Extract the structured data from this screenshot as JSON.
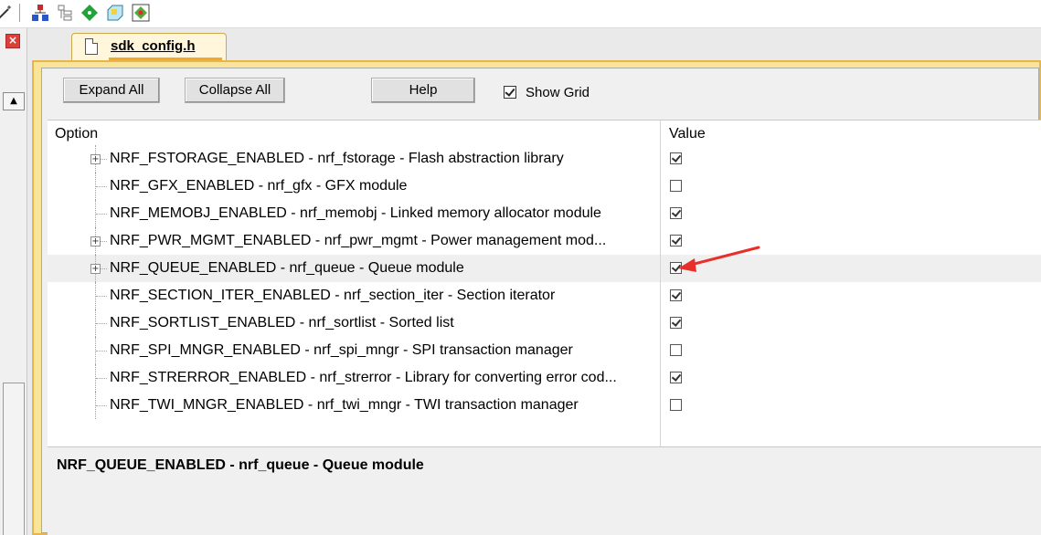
{
  "toolbar": {
    "icons": [
      "wand-icon",
      "hierarchy-icon",
      "grid-tree-icon",
      "diamond-move-icon",
      "tag-icon",
      "tree-view-icon"
    ]
  },
  "tab": {
    "label": "sdk_config.h"
  },
  "buttons": {
    "expand_all": "Expand All",
    "collapse_all": "Collapse All",
    "help": "Help"
  },
  "show_grid": {
    "label": "Show Grid",
    "checked": true
  },
  "grid": {
    "col_option": "Option",
    "col_value": "Value",
    "rows": [
      {
        "text": "NRF_FSTORAGE_ENABLED - nrf_fstorage - Flash abstraction library",
        "expandable": true,
        "checked": true
      },
      {
        "text": "NRF_GFX_ENABLED  - nrf_gfx - GFX module",
        "expandable": false,
        "checked": false
      },
      {
        "text": "NRF_MEMOBJ_ENABLED  - nrf_memobj - Linked memory allocator module",
        "expandable": false,
        "checked": true
      },
      {
        "text": "NRF_PWR_MGMT_ENABLED - nrf_pwr_mgmt - Power management mod...",
        "expandable": true,
        "checked": true
      },
      {
        "text": "NRF_QUEUE_ENABLED - nrf_queue - Queue module",
        "expandable": true,
        "checked": true,
        "selected": true
      },
      {
        "text": "NRF_SECTION_ITER_ENABLED  - nrf_section_iter - Section iterator",
        "expandable": false,
        "checked": true
      },
      {
        "text": "NRF_SORTLIST_ENABLED  - nrf_sortlist - Sorted list",
        "expandable": false,
        "checked": true
      },
      {
        "text": "NRF_SPI_MNGR_ENABLED  - nrf_spi_mngr - SPI transaction manager",
        "expandable": false,
        "checked": false
      },
      {
        "text": "NRF_STRERROR_ENABLED  - nrf_strerror - Library for converting error cod...",
        "expandable": false,
        "checked": true
      },
      {
        "text": "NRF_TWI_MNGR_ENABLED  - nrf_twi_mngr - TWI transaction manager",
        "expandable": false,
        "checked": false
      }
    ]
  },
  "description": {
    "text": "NRF_QUEUE_ENABLED - nrf_queue - Queue module"
  },
  "annotation": {
    "color": "#e8302a"
  }
}
